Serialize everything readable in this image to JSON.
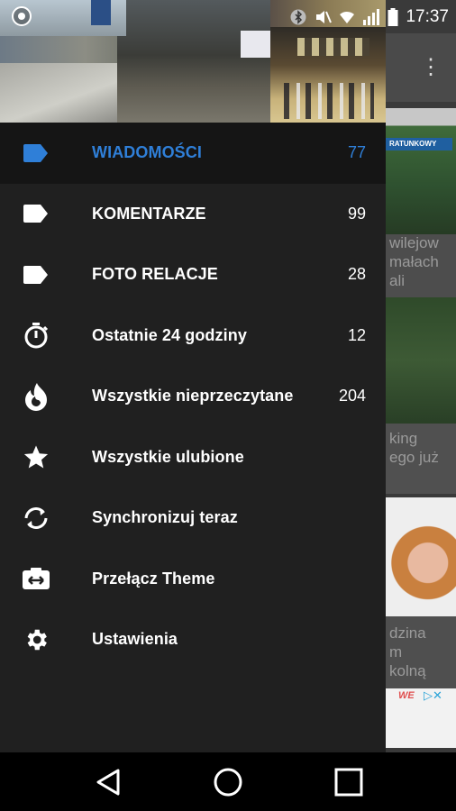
{
  "status_bar": {
    "time": "17:37",
    "icons": [
      "app-notification-icon",
      "bluetooth-icon",
      "vibrate-mute-icon",
      "wifi-icon",
      "signal-icon",
      "battery-icon"
    ]
  },
  "background_app": {
    "card_texts": [
      {
        "text": "wilejow\nmałach\nali"
      },
      {
        "text": "king\nego już"
      },
      {
        "text": "dzina\nm\nkolną"
      }
    ],
    "ad_text": "WE",
    "menu_icon": "overflow-menu-icon"
  },
  "drawer": {
    "header_image": "street-and-mall-photo",
    "items": [
      {
        "label": "WIADOMOŚCI",
        "count": "77",
        "icon": "label-tag-icon",
        "active": true
      },
      {
        "label": "KOMENTARZE",
        "count": "99",
        "icon": "label-tag-icon",
        "active": false
      },
      {
        "label": "FOTO RELACJE",
        "count": "28",
        "icon": "label-tag-icon",
        "active": false
      },
      {
        "label": "Ostatnie 24 godziny",
        "count": "12",
        "icon": "timer-icon",
        "active": false
      },
      {
        "label": "Wszystkie nieprzeczytane",
        "count": "204",
        "icon": "flame-icon",
        "active": false
      },
      {
        "label": "Wszystkie ulubione",
        "count": "",
        "icon": "star-icon",
        "active": false
      },
      {
        "label": "Synchronizuj teraz",
        "count": "",
        "icon": "sync-icon",
        "active": false
      },
      {
        "label": "Przełącz Theme",
        "count": "",
        "icon": "switch-theme-icon",
        "active": false
      },
      {
        "label": "Ustawienia",
        "count": "",
        "icon": "settings-gear-icon",
        "active": false
      }
    ]
  },
  "colors": {
    "drawer_bg": "#202020",
    "active_item_bg": "#151515",
    "accent": "#2f7fd8",
    "text": "#ffffff"
  },
  "nav_bar": {
    "buttons": [
      "back-icon",
      "home-icon",
      "recents-icon"
    ]
  }
}
